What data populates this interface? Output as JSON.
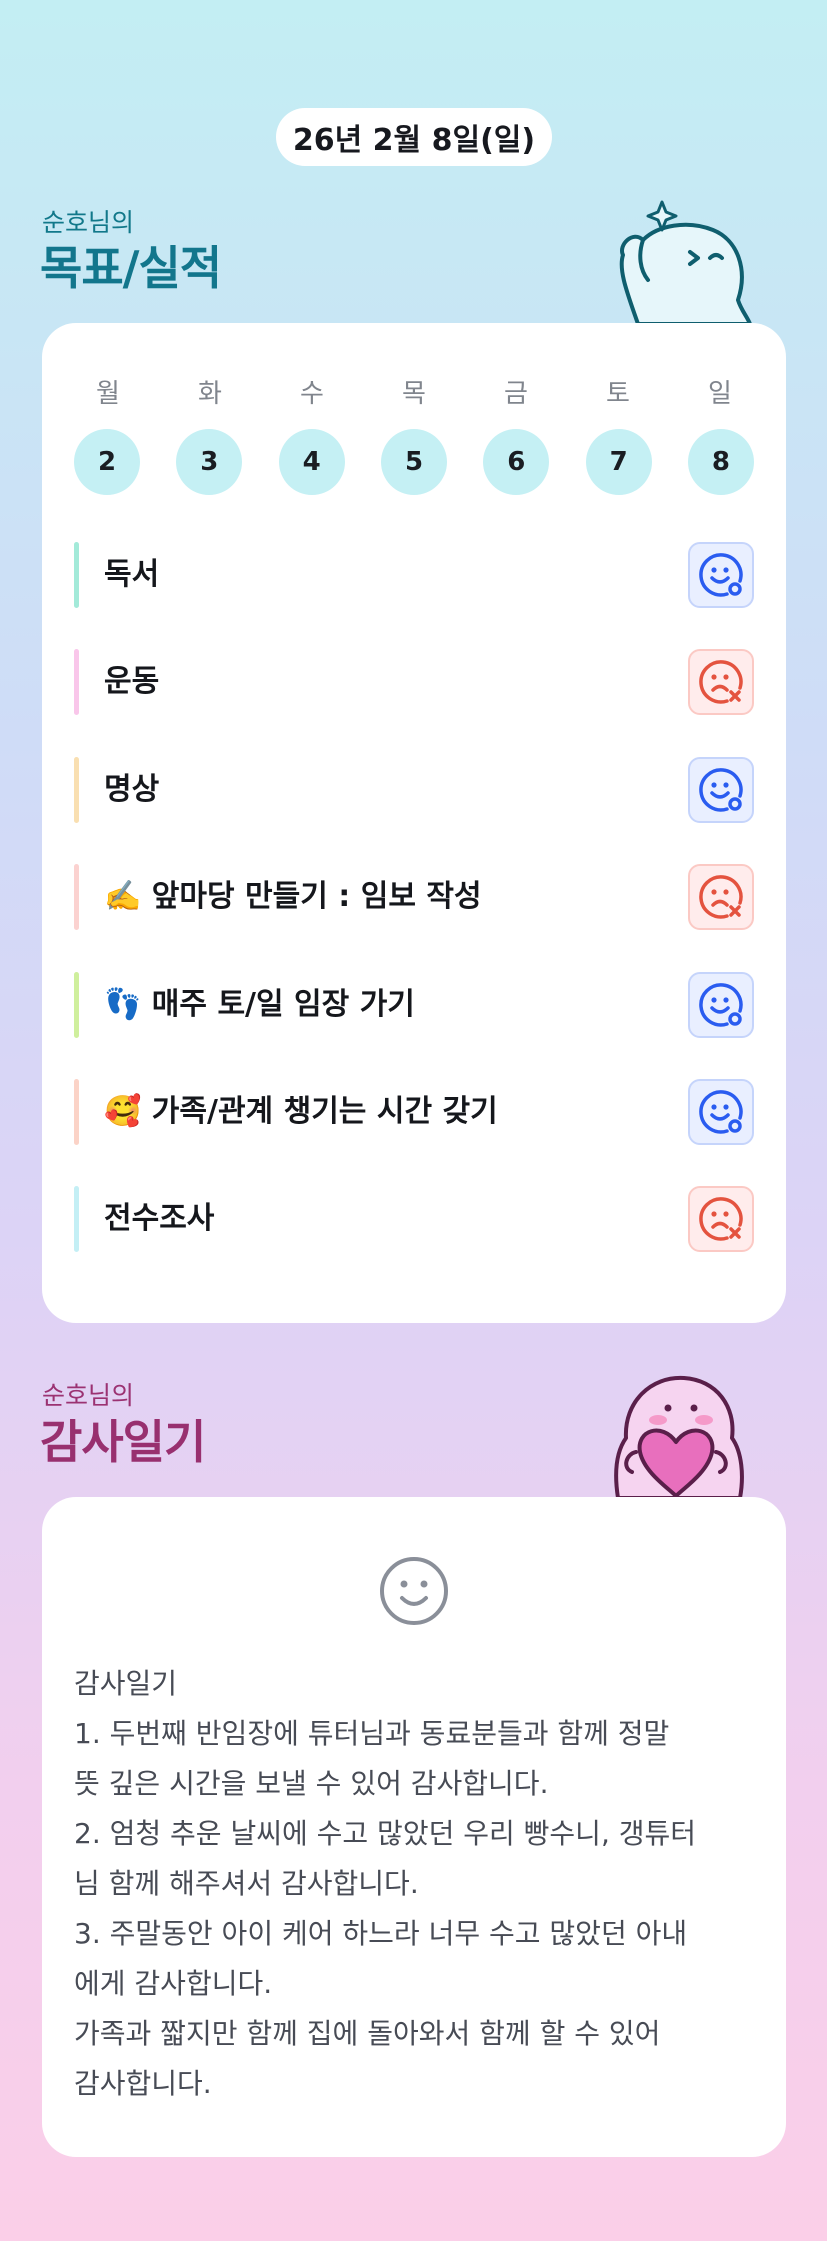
{
  "header": {
    "date": "26년 2월 8일(일)"
  },
  "goals_section": {
    "subtitle": "순호님의",
    "title": "목표/실적",
    "weekdays": [
      "월",
      "화",
      "수",
      "목",
      "금",
      "토",
      "일"
    ],
    "days": [
      "2",
      "3",
      "4",
      "5",
      "6",
      "7",
      "8"
    ],
    "items": [
      {
        "label": "독서",
        "status": "done",
        "bar_color": "#a3ead9",
        "status_icon": "happy-face-icon"
      },
      {
        "label": "운동",
        "status": "not-done",
        "bar_color": "#f9c6ea",
        "status_icon": "sad-face-icon"
      },
      {
        "label": "명상",
        "status": "done",
        "bar_color": "#f9dfb1",
        "status_icon": "happy-face-icon"
      },
      {
        "label": "✍️ 앞마당 만들기 : 임보 작성",
        "status": "not-done",
        "bar_color": "#fbd2d0",
        "status_icon": "sad-face-icon"
      },
      {
        "label": "👣 매주 토/일 임장 가기",
        "status": "done",
        "bar_color": "#cfef9d",
        "status_icon": "happy-face-icon"
      },
      {
        "label": "🥰 가족/관계 챙기는 시간 갖기",
        "status": "done",
        "bar_color": "#fbd3c7",
        "status_icon": "happy-face-icon"
      },
      {
        "label": "전수조사",
        "status": "not-done",
        "bar_color": "#c4eff5",
        "status_icon": "sad-face-icon"
      }
    ]
  },
  "gratitude_section": {
    "subtitle": "순호님의",
    "title": "감사일기",
    "mood_icon": "smile-face-icon",
    "lines": [
      "감사일기",
      "1. 두번째 반임장에 튜터님과 동료분들과 함께 정말",
      "뜻 깊은 시간을 보낼 수 있어 감사합니다.",
      "2. 엄청 추운 날씨에 수고 많았던 우리 빵수니, 갱튜터",
      "님 함께 해주셔서 감사합니다.",
      "3. 주말동안 아이 케어 하느라 너무 수고 많았던 아내",
      "에게 감사합니다.",
      "가족과 짧지만 함께 집에 돌아와서 함께 할 수 있어",
      "감사합니다."
    ]
  },
  "colors": {
    "goal_title": "#12768c",
    "gratitude_title": "#98306f",
    "day_circle": "#c5f0f4",
    "done_icon": "#2a5cf0",
    "not_done_icon": "#e4533f"
  }
}
